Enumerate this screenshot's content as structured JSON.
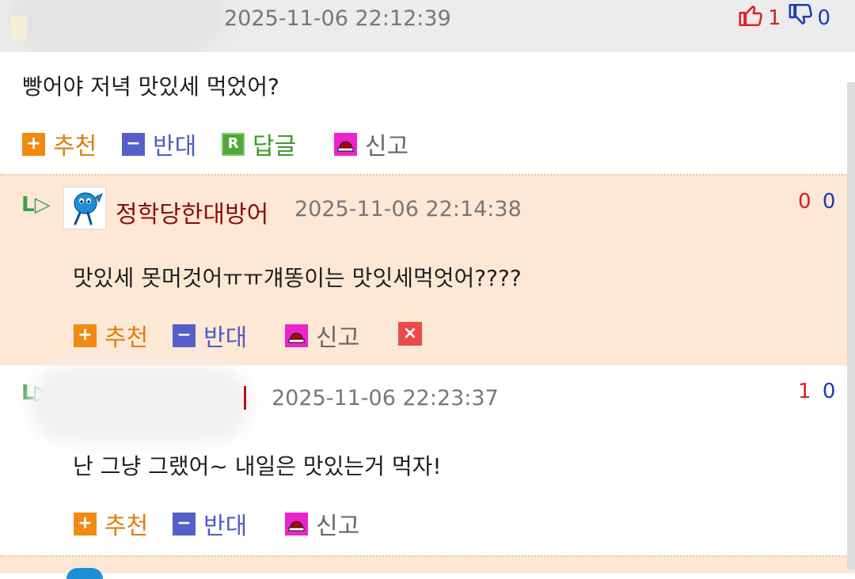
{
  "comments": [
    {
      "nickname": "",
      "date": "2025-11-06 22:12:39",
      "up": "1",
      "down": "0",
      "text": "빵어야 저녁 맛있세 먹었어?",
      "actions": {
        "recommend": "추천",
        "oppose": "반대",
        "reply": "답글",
        "report": "신고",
        "reply_icon": "R"
      }
    },
    {
      "nickname": "정학당한대방어",
      "date": "2025-11-06 22:14:38",
      "up": "0",
      "down": "0",
      "text": "맛있세 못머것어ㅠㅠ걔똥이는 맛잇세먹엇어????",
      "actions": {
        "recommend": "추천",
        "oppose": "반대",
        "report": "신고"
      }
    },
    {
      "nickname": "",
      "date": "2025-11-06 22:23:37",
      "up": "1",
      "down": "0",
      "text": "난 그냥 그랬어~ 내일은 맛있는거 먹자!",
      "actions": {
        "recommend": "추천",
        "oppose": "반대",
        "report": "신고"
      }
    }
  ],
  "icons": {
    "plus": "+",
    "minus": "−",
    "delete": "×",
    "reply_arrow": "L▷",
    "thumb_up": "thumbs-up-outline",
    "thumb_down": "thumbs-down-outline",
    "report": "siren"
  },
  "colors": {
    "recommend": "#f08a12",
    "oppose": "#5460c8",
    "reply": "#52a63c",
    "report": "#ee22cc",
    "delete": "#ec4a4a",
    "nickname": "#8b0d0d",
    "reply_bg": "#fde8d6"
  }
}
